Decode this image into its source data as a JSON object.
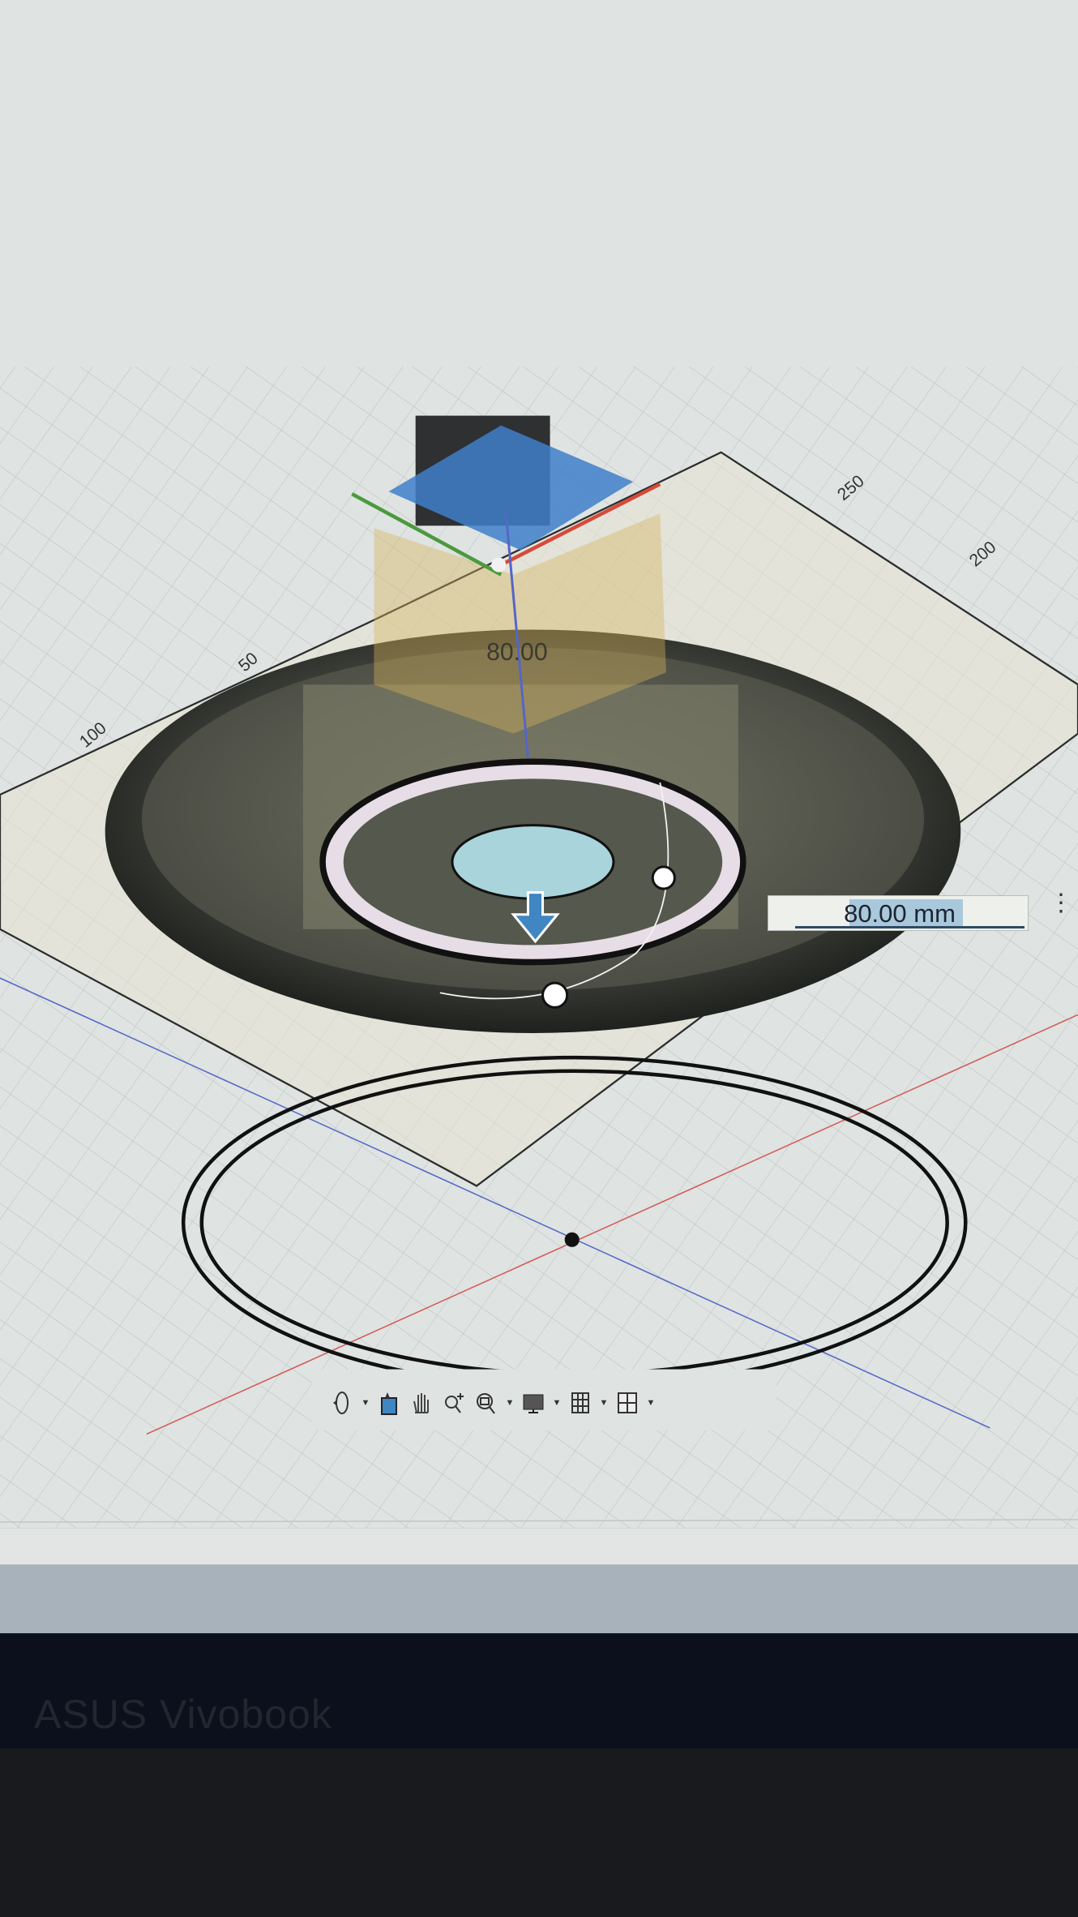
{
  "viewport": {
    "grid_labels": [
      "250",
      "200",
      "50",
      "100"
    ],
    "dimension_label": "80.00"
  },
  "dimension_input": {
    "value": "80.00 mm",
    "more_options": "⋮"
  },
  "navigation_toolbar": {
    "items": [
      {
        "name": "orbit",
        "has_dropdown": true
      },
      {
        "name": "look-at",
        "has_dropdown": false
      },
      {
        "name": "pan",
        "has_dropdown": false
      },
      {
        "name": "zoom",
        "has_dropdown": false
      },
      {
        "name": "fit",
        "has_dropdown": true
      },
      {
        "name": "display-settings",
        "has_dropdown": true
      },
      {
        "name": "grid-and-snaps",
        "has_dropdown": true
      },
      {
        "name": "viewports",
        "has_dropdown": true
      }
    ]
  },
  "device": {
    "brand": "ASUS Vivobook"
  },
  "colors": {
    "canvas": "#dde2e0",
    "accent_blue": "#3f7fc9",
    "x_axis": "#d64a3a",
    "y_axis": "#4a9a3c",
    "z_axis": "#5566c8",
    "selection": "#a9c8dc"
  }
}
